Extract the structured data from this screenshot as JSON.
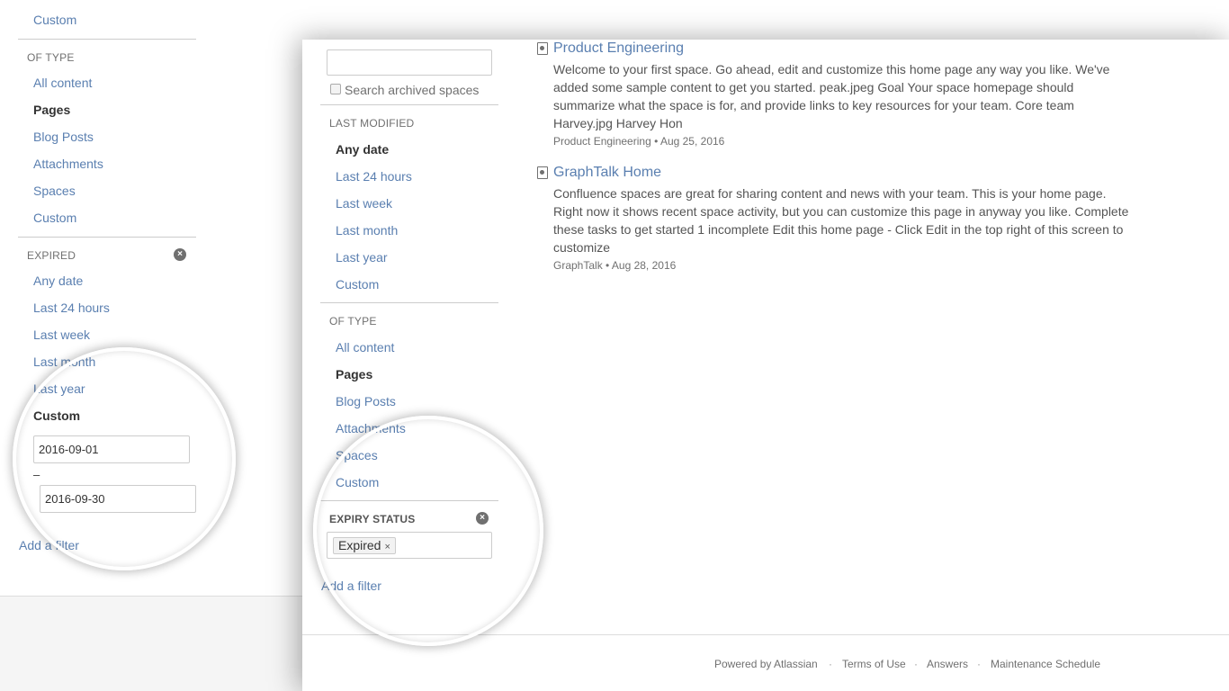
{
  "back_panel": {
    "top_partial_link": "Custom",
    "of_type": {
      "heading": "OF TYPE",
      "items": [
        {
          "label": "All content",
          "active": false
        },
        {
          "label": "Pages",
          "active": true
        },
        {
          "label": "Blog Posts",
          "active": false
        },
        {
          "label": "Attachments",
          "active": false
        },
        {
          "label": "Spaces",
          "active": false
        },
        {
          "label": "Custom",
          "active": false
        }
      ]
    },
    "expired": {
      "heading": "EXPIRED",
      "items": [
        {
          "label": "Any date",
          "active": false
        },
        {
          "label": "Last 24 hours",
          "active": false
        },
        {
          "label": "Last week",
          "active": false
        },
        {
          "label": "Last month",
          "active": false
        },
        {
          "label": "Last year",
          "active": false
        },
        {
          "label": "Custom",
          "active": true
        }
      ],
      "date_from": "2016-09-01",
      "date_separator": "–",
      "date_to": "2016-09-30"
    },
    "add_filter": "Add a filter"
  },
  "front_panel": {
    "search": {
      "value": "",
      "archived_label": "Search archived spaces",
      "archived_checked": false
    },
    "last_modified": {
      "heading": "LAST MODIFIED",
      "items": [
        {
          "label": "Any date",
          "active": true
        },
        {
          "label": "Last 24 hours",
          "active": false
        },
        {
          "label": "Last week",
          "active": false
        },
        {
          "label": "Last month",
          "active": false
        },
        {
          "label": "Last year",
          "active": false
        },
        {
          "label": "Custom",
          "active": false
        }
      ]
    },
    "of_type": {
      "heading": "OF TYPE",
      "items": [
        {
          "label": "All content",
          "active": false
        },
        {
          "label": "Pages",
          "active": true
        },
        {
          "label": "Blog Posts",
          "active": false
        },
        {
          "label": "Attachments",
          "active": false
        },
        {
          "label": "Spaces",
          "active": false
        },
        {
          "label": "Custom",
          "active": false
        }
      ]
    },
    "expiry_status": {
      "heading": "EXPIRY STATUS",
      "tag": "Expired",
      "tag_remove": "×"
    },
    "add_filter": "Add a filter",
    "results": [
      {
        "title": "Product Engineering",
        "excerpt": "Welcome to your first space. Go ahead, edit and customize this home page any way you like. We've added some sample content to get you started. peak.jpeg   Goal Your space homepage should summarize what the space is for, and provide links to key resources for your team.    Core team Harvey.jpg Harvey Hon",
        "meta": "Product Engineering • Aug 25, 2016",
        "icon": "page-icon"
      },
      {
        "title": "GraphTalk Home",
        "excerpt": "Confluence spaces are great for sharing content and news with your team. This is your home page. Right now it shows recent space activity, but you can customize this page in anyway you like. Complete these tasks to get started 1 incomplete Edit this home page - Click Edit in the top right of this screen to customize",
        "meta": "GraphTalk • Aug 28, 2016",
        "icon": "page-icon"
      }
    ],
    "footer": {
      "powered": "Powered by Atlassian",
      "terms": "Terms of Use",
      "answers": "Answers",
      "maintenance": "Maintenance Schedule",
      "separator": "·"
    }
  }
}
